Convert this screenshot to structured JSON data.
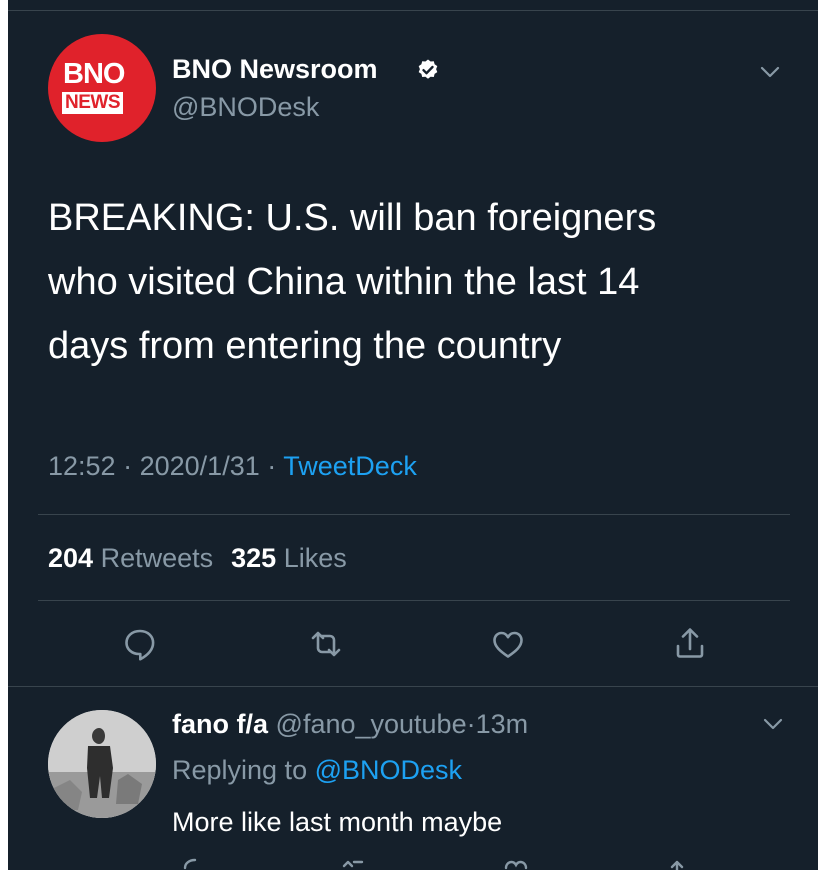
{
  "tweet": {
    "author_name": "BNO Newsroom",
    "author_handle": "@BNODesk",
    "avatar_logo": {
      "line1": "BNO",
      "line2": "NEWS"
    },
    "text_lines": [
      "BREAKING: U.S. will ban foreigners",
      "who visited China within the last 14",
      "days from entering the country"
    ],
    "time": "12:52",
    "date": "2020/1/31",
    "separator": "·",
    "source": "TweetDeck",
    "retweets_count": "204",
    "retweets_label": "Retweets",
    "likes_count": "325",
    "likes_label": "Likes",
    "actions": [
      "reply-icon",
      "retweet-icon",
      "like-icon",
      "share-icon"
    ]
  },
  "reply": {
    "author_name": "fano f/a",
    "author_handle": "@fano_youtube",
    "separator": "·",
    "time_ago": "13m",
    "replying_prefix": "Replying to",
    "replying_to": "@BNODesk",
    "text": "More like last month maybe"
  },
  "colors": {
    "background": "#15202b",
    "text": "#ffffff",
    "secondary": "#8899a6",
    "link": "#1da1f2",
    "divider": "#38444d",
    "brand_red": "#e0222b"
  }
}
